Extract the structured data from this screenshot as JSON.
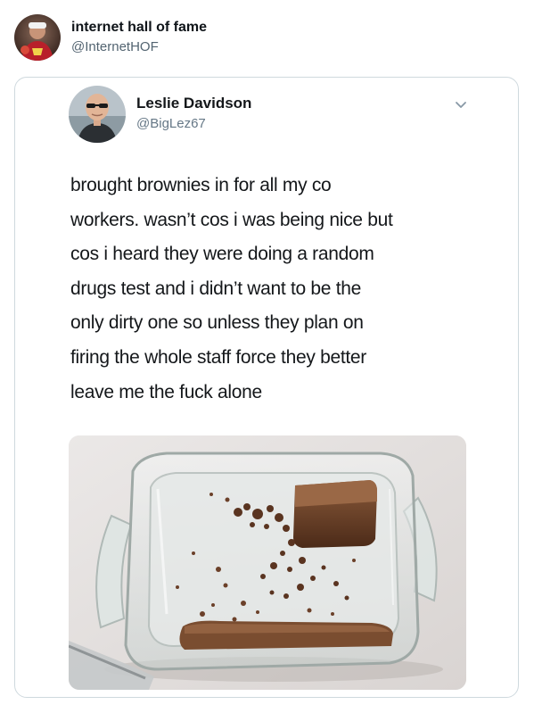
{
  "outer_tweet": {
    "display_name": "internet hall of fame",
    "handle": "@InternetHOF",
    "avatar_icon": "profile-photo"
  },
  "embedded_tweet": {
    "display_name": "Leslie Davidson",
    "handle": "@BigLez67",
    "avatar_icon": "profile-photo",
    "menu_icon": "chevron-down-icon",
    "text_lines": [
      "brought brownies in for all my co",
      "workers. wasn’t cos i was being nice but",
      "cos i heard they were doing a random",
      "drugs test and i didn’t want to be the",
      "only dirty one so unless they plan on",
      "firing the whole staff force they better",
      "leave me the fuck alone"
    ],
    "media_description_icon": "photo-glass-dish-brownie-crumbs"
  },
  "colors": {
    "name_text": "#0f1419",
    "handle_text": "#536471",
    "card_border": "#cfd9de",
    "body_text": "#14171a",
    "chevron": "#8899a6"
  }
}
